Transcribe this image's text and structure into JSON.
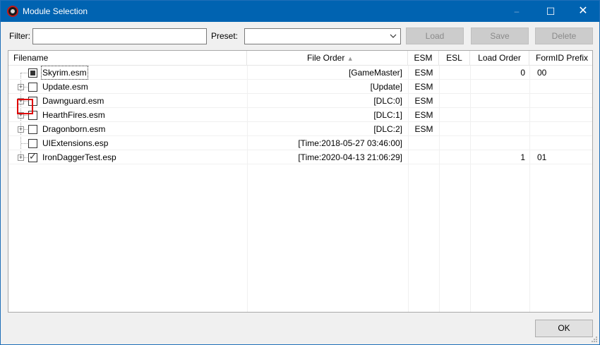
{
  "window": {
    "title": "Module Selection"
  },
  "titlebar_buttons": {
    "minimize": "–",
    "maximize": "☐",
    "close": "✕"
  },
  "toolbar": {
    "filter_label": "Filter:",
    "filter_value": "",
    "preset_label": "Preset:",
    "preset_value": "",
    "load_label": "Load",
    "save_label": "Save",
    "delete_label": "Delete"
  },
  "columns": {
    "filename": "Filename",
    "file_order": "File Order",
    "sort_arrow": "▲",
    "esm": "ESM",
    "esl": "ESL",
    "load_order": "Load Order",
    "formid_prefix": "FormID Prefix"
  },
  "rows": [
    {
      "filename": "Skyrim.esm",
      "file_order": "[GameMaster]",
      "esm": "ESM",
      "esl": "",
      "load_order": "0",
      "prefix": "00",
      "check": "partial",
      "expander": false
    },
    {
      "filename": "Update.esm",
      "file_order": "[Update]",
      "esm": "ESM",
      "esl": "",
      "load_order": "",
      "prefix": "",
      "check": "unchecked",
      "expander": true
    },
    {
      "filename": "Dawnguard.esm",
      "file_order": "[DLC:0]",
      "esm": "ESM",
      "esl": "",
      "load_order": "",
      "prefix": "",
      "check": "unchecked",
      "expander": true
    },
    {
      "filename": "HearthFires.esm",
      "file_order": "[DLC:1]",
      "esm": "ESM",
      "esl": "",
      "load_order": "",
      "prefix": "",
      "check": "unchecked",
      "expander": true
    },
    {
      "filename": "Dragonborn.esm",
      "file_order": "[DLC:2]",
      "esm": "ESM",
      "esl": "",
      "load_order": "",
      "prefix": "",
      "check": "unchecked",
      "expander": true
    },
    {
      "filename": "UIExtensions.esp",
      "file_order": "[Time:2018-05-27 03:46:00]",
      "esm": "",
      "esl": "",
      "load_order": "",
      "prefix": "",
      "check": "unchecked",
      "expander": false
    },
    {
      "filename": "IronDaggerTest.esp",
      "file_order": "[Time:2020-04-13 21:06:29]",
      "esm": "",
      "esl": "",
      "load_order": "1",
      "prefix": "01",
      "check": "checked",
      "expander": true
    }
  ],
  "footer": {
    "ok_label": "OK"
  },
  "colors": {
    "titlebar": "#0063b1",
    "highlight": "#e00000"
  }
}
